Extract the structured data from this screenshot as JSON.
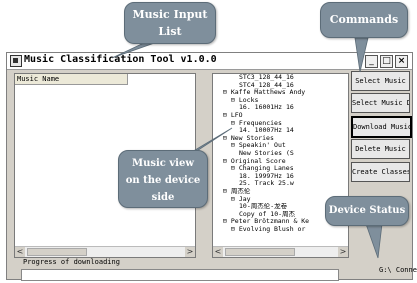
{
  "window": {
    "title": "Music Classification Tool v1.0.0",
    "controls": [
      "_",
      "□",
      "×"
    ]
  },
  "left_panel": {
    "column_header": "Music Name",
    "rows": []
  },
  "tree_items": [
    {
      "text": "STC3_128_44_16",
      "indent": 4
    },
    {
      "text": "STC4_128_44_16",
      "indent": 4
    },
    {
      "text": "⊟ Kaffe Matthews Andy",
      "indent": 2
    },
    {
      "text": "⊟ Locks",
      "indent": 3
    },
    {
      "text": "16. 16001Hz 16",
      "indent": 4
    },
    {
      "text": "⊟ LFO",
      "indent": 2
    },
    {
      "text": "⊟ Frequencies",
      "indent": 3
    },
    {
      "text": "14. 10007Hz 14",
      "indent": 4
    },
    {
      "text": "⊟ New Stories",
      "indent": 2
    },
    {
      "text": "⊟ Speakin' Out",
      "indent": 3
    },
    {
      "text": "New Stories (S",
      "indent": 4
    },
    {
      "text": "⊟ Original Score",
      "indent": 2
    },
    {
      "text": "⊟ Changing Lanes",
      "indent": 3
    },
    {
      "text": "18. 19997Hz 16",
      "indent": 4
    },
    {
      "text": "25. Track 25.w",
      "indent": 4
    },
    {
      "text": "⊟ 周杰伦",
      "indent": 2
    },
    {
      "text": "⊟ Jay",
      "indent": 3
    },
    {
      "text": "10-周杰伦-龙卷",
      "indent": 4
    },
    {
      "text": "Copy of 10-周杰",
      "indent": 4
    },
    {
      "text": "⊟ Peter Brötzmann & Ke",
      "indent": 2
    },
    {
      "text": "⊟ Evolving Blush or",
      "indent": 3
    }
  ],
  "commands": {
    "select_music": "Select Music",
    "select_music_dir": "Select Music Dir",
    "download_music": "Download Music",
    "delete_music": "Delete Music",
    "create_classes": "Create Classes"
  },
  "progress": {
    "label": "Progress of downloading",
    "value": 0
  },
  "status": {
    "text": "G:\\ Connected"
  },
  "callouts": {
    "music_input_list": [
      "Music Input",
      "List"
    ],
    "commands": [
      "Commands"
    ],
    "music_view": [
      "Music view",
      "on the device",
      "side"
    ],
    "device_status": [
      "Device Status"
    ]
  },
  "scroll_arrows": {
    "left": "<",
    "right": ">"
  },
  "colors": {
    "callout_fill": "#7f8f9c",
    "window_face": "#d4d0c8",
    "progress_fill": "#3a6ea5"
  }
}
